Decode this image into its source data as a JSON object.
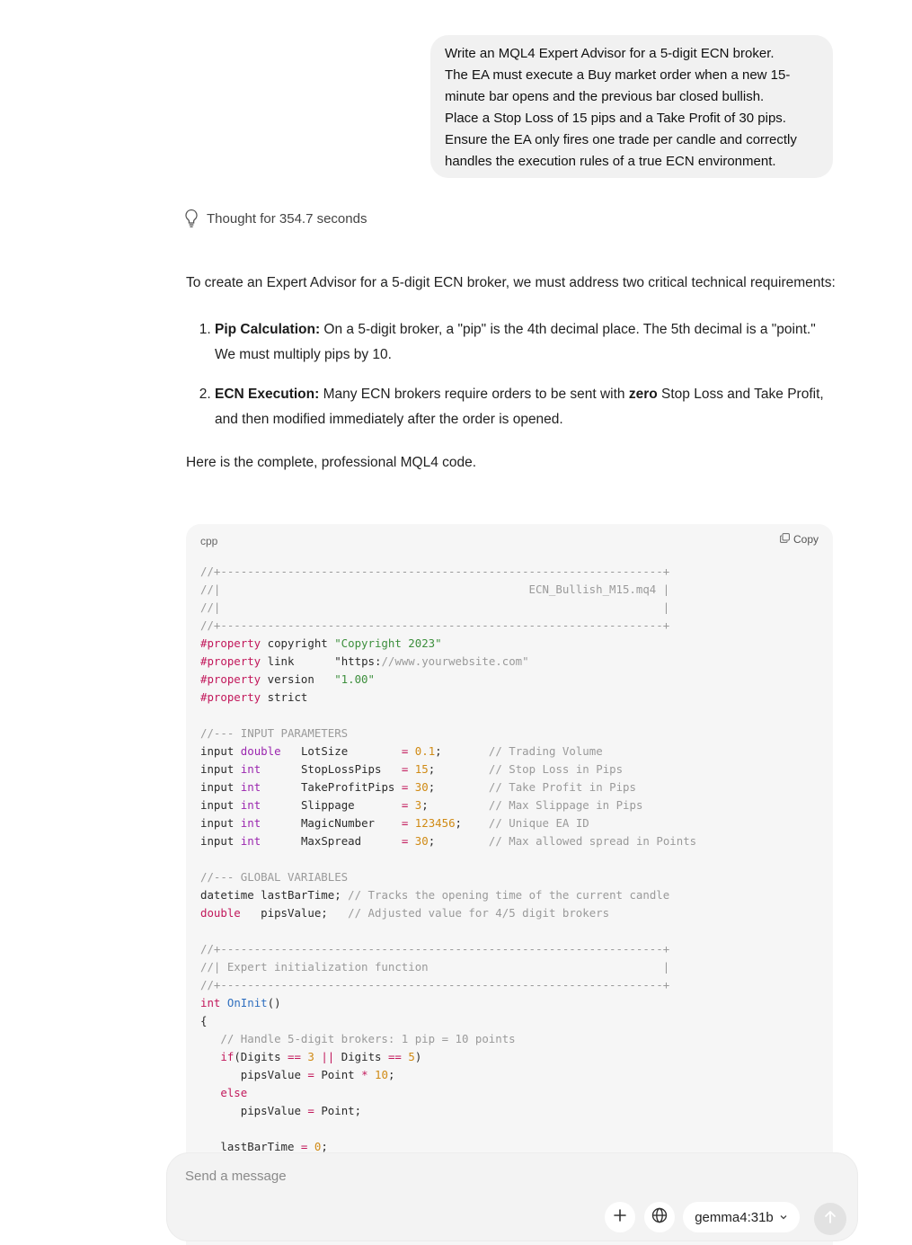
{
  "user_message": {
    "lines": [
      "Write an MQL4 Expert Advisor for a 5-digit ECN broker.",
      "The EA must execute a Buy market order when a new 15-",
      "minute bar opens and the previous bar closed bullish.",
      "Place a Stop Loss of 15 pips and a Take Profit of 30 pips.",
      "Ensure the EA only fires one trade per candle and correctly",
      "handles the execution rules of a true ECN environment."
    ]
  },
  "thought": {
    "label": "Thought for 354.7 seconds",
    "icon": "lightbulb-icon"
  },
  "answer": {
    "intro": "To create an Expert Advisor for a 5-digit ECN broker, we must address two critical technical requirements:",
    "points": [
      {
        "title": "Pip Calculation:",
        "text": " On a 5-digit broker, a \"pip\" is the 4th decimal place. The 5th decimal is a \"point.\" We must multiply pips by 10."
      },
      {
        "title": "ECN Execution:",
        "text_before": " Many ECN brokers require orders to be sent with ",
        "emph": "zero",
        "text_after": " Stop Loss and Take Profit, and then modified immediately after the order is opened."
      }
    ],
    "outro": "Here is the complete, professional MQL4 code."
  },
  "code_block": {
    "language": "cpp",
    "copy_label": "Copy",
    "lines": [
      "//+------------------------------------------------------------------+",
      "//|                                              ECN_Bullish_M15.mq4 |",
      "//|                                                                  |",
      "//+------------------------------------------------------------------+",
      "#property copyright \"Copyright 2023\"",
      "#property link      \"https://www.yourwebsite.com\"",
      "#property version   \"1.00\"",
      "#property strict",
      "",
      "//--- INPUT PARAMETERS",
      "input double   LotSize        = 0.1;       // Trading Volume",
      "input int      StopLossPips   = 15;        // Stop Loss in Pips",
      "input int      TakeProfitPips = 30;        // Take Profit in Pips",
      "input int      Slippage       = 3;         // Max Slippage in Pips",
      "input int      MagicNumber    = 123456;    // Unique EA ID",
      "input int      MaxSpread      = 30;        // Max allowed spread in Points",
      "",
      "//--- GLOBAL VARIABLES",
      "datetime lastBarTime; // Tracks the opening time of the current candle",
      "double   pipsValue;   // Adjusted value for 4/5 digit brokers",
      "",
      "//+------------------------------------------------------------------+",
      "//| Expert initialization function                                   |",
      "//+------------------------------------------------------------------+",
      "int OnInit()",
      "{",
      "   // Handle 5-digit brokers: 1 pip = 10 points",
      "   if(Digits == 3 || Digits == 5)",
      "      pipsValue = Point * 10;",
      "   else",
      "      pipsValue = Point;",
      "",
      "   lastBarTime = 0;"
    ]
  },
  "composer": {
    "placeholder": "Send a message",
    "model": "gemma4:31b"
  }
}
